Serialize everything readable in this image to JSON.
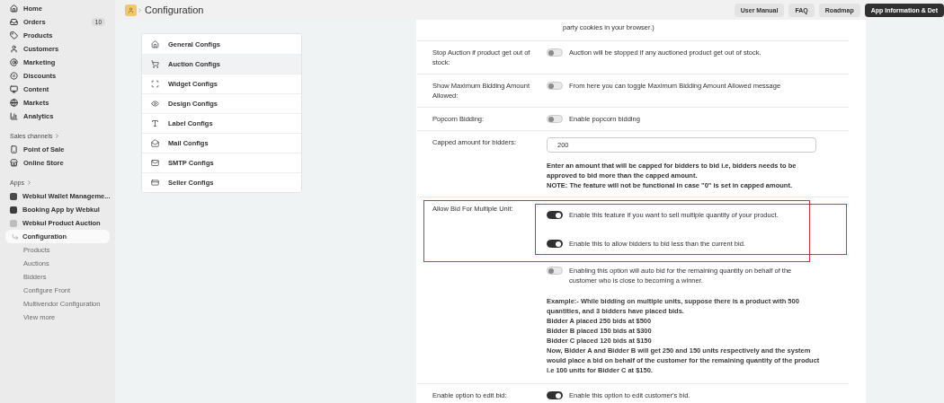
{
  "sidebar": {
    "nav": [
      {
        "label": "Home"
      },
      {
        "label": "Orders",
        "badge": "10"
      },
      {
        "label": "Products"
      },
      {
        "label": "Customers"
      },
      {
        "label": "Marketing"
      },
      {
        "label": "Discounts"
      },
      {
        "label": "Content"
      },
      {
        "label": "Markets"
      },
      {
        "label": "Analytics"
      }
    ],
    "sales_channels": {
      "heading": "Sales channels",
      "items": [
        {
          "label": "Point of Sale"
        },
        {
          "label": "Online Store"
        }
      ]
    },
    "apps": {
      "heading": "Apps",
      "items": [
        {
          "label": "Webkul Wallet Manageme..."
        },
        {
          "label": "Booking App by Webkul"
        },
        {
          "label": "Webkul Product Auction",
          "children": [
            {
              "label": "Configuration",
              "selected": true
            },
            {
              "label": "Products",
              "selected": false
            },
            {
              "label": "Auctions",
              "selected": false
            },
            {
              "label": "Bidders",
              "selected": false
            },
            {
              "label": "Configure Front",
              "selected": false
            },
            {
              "label": "Multivendor Configuration",
              "selected": false
            },
            {
              "label": "View more",
              "selected": false
            }
          ]
        }
      ]
    }
  },
  "topbar": {
    "title": "Configuration",
    "buttons": [
      {
        "label": "User Manual",
        "kind": "default"
      },
      {
        "label": "FAQ",
        "kind": "default"
      },
      {
        "label": "Roadmap",
        "kind": "default"
      },
      {
        "label": "App Information & Det",
        "kind": "primary"
      }
    ]
  },
  "config_menu": [
    {
      "label": "General Configs",
      "selected": false
    },
    {
      "label": "Auction Configs",
      "selected": true
    },
    {
      "label": "Widget Configs",
      "selected": false
    },
    {
      "label": "Design Configs",
      "selected": false
    },
    {
      "label": "Label Configs",
      "selected": false
    },
    {
      "label": "Mail Configs",
      "selected": false
    },
    {
      "label": "SMTP Configs",
      "selected": false
    },
    {
      "label": "Seller Configs",
      "selected": false
    }
  ],
  "settings": [
    {
      "kind": "note",
      "text": "party cookies in your browser.)"
    },
    {
      "kind": "toggles",
      "label": "Stop Auction if product get out of stock:",
      "toggles": [
        {
          "on": false,
          "text": "Auction will be stopped if any auctioned product get out of stock."
        }
      ]
    },
    {
      "kind": "toggles",
      "label": "Show Maximum Bidding Amount Allowed:",
      "toggles": [
        {
          "on": false,
          "text": "From here you can toggle Maximum Bidding Amount Allowed message"
        }
      ]
    },
    {
      "kind": "toggles",
      "label": "Popcorn Bidding:",
      "toggles": [
        {
          "on": false,
          "text": "Enable popcorn bidding"
        }
      ]
    },
    {
      "kind": "input",
      "label": "Capped amount for bidders:",
      "value": "200",
      "help": [
        "Enter an amount that will be capped for bidders to bid i.e, bidders needs to be approved to bid more than the capped amount.",
        "NOTE: The feature will not be functional in case \"0\" is set in capped amount."
      ]
    },
    {
      "kind": "toggles",
      "label": "Allow Bid For Multiple Unit:",
      "highlighted": true,
      "toggles": [
        {
          "on": true,
          "text": "Enable this feature if you want to sell multiple quantity of your product."
        },
        {
          "on": true,
          "text": "Enable this to allow bidders to bid less than the current bid."
        }
      ]
    },
    {
      "kind": "continuation",
      "toggles": [
        {
          "on": false,
          "text": "Enabling this option will auto bid for the remaining quantity on behalf of the customer who is close to becoming a winner."
        }
      ],
      "example": [
        "**Example:-** While bidding on multiple units, suppose there is a product with 500 quantities, and 3 bidders have placed bids.",
        "Bidder A placed 250 bids at $500",
        "Bidder B placed 150 bids at $300",
        "Bidder C placed 120 bids at $150",
        "Now, Bidder A and Bidder B will get 250 and 150 units respectively and the system would place a bid on behalf of the customer for the remaining quantity of the product i.e 100 units for Bidder C at $150."
      ]
    },
    {
      "kind": "toggles",
      "label": "Enable option to edit bid:",
      "toggles": [
        {
          "on": true,
          "text": "Enable this option to edit customer's bid."
        }
      ]
    }
  ]
}
